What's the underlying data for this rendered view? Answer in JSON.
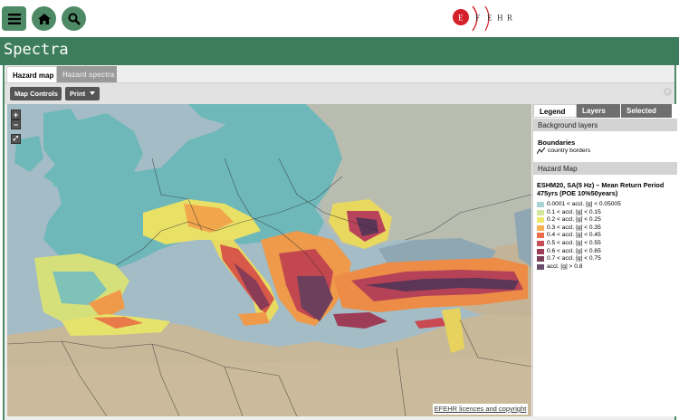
{
  "header": {
    "menu_icon": "hamburger-menu-icon",
    "home_icon": "home-icon",
    "search_icon": "search-icon",
    "logo": {
      "letters": "E F E H R",
      "accent": "#d4202a"
    },
    "brand_color": "#4e8a66"
  },
  "title": "Spectra",
  "tabs": [
    {
      "label": "Hazard map",
      "active": true
    },
    {
      "label": "Hazard spectra",
      "active": false
    }
  ],
  "toolbar": {
    "map_controls": "Map Controls",
    "print": "Print"
  },
  "map": {
    "zoom_in": "+",
    "zoom_out": "−",
    "copyright": "EFEHR licences and copyright"
  },
  "panel": {
    "tabs": [
      "Legend",
      "Layers",
      "Selected"
    ],
    "background_layers": "Background layers",
    "boundaries": "Boundaries",
    "country_borders": "country borders",
    "hazard_map": "Hazard Map",
    "legend_title": "ESHM20, SA(5 Hz) – Mean Return Period 475yrs (POE 10%50years)",
    "legend": [
      {
        "label": "0.0001 < accl. [g] < 0.05005",
        "color": "#a8d4d4"
      },
      {
        "label": "0.1 < accl. [g] < 0.15",
        "color": "#d2e69c"
      },
      {
        "label": "0.2 < accl. [g] < 0.25",
        "color": "#efe86a"
      },
      {
        "label": "0.3 < accl. [g] < 0.35",
        "color": "#f4b052"
      },
      {
        "label": "0.4 < accl. [g] < 0.45",
        "color": "#ea6e4a"
      },
      {
        "label": "0.5 < accl. [g] < 0.55",
        "color": "#c74d55"
      },
      {
        "label": "0.6 < accl. [g] < 0.65",
        "color": "#9c3c56"
      },
      {
        "label": "0.7 < accl. [g] < 0.75",
        "color": "#7a3e5a"
      },
      {
        "label": "accl. [g] > 0.8",
        "color": "#6a4f6c"
      }
    ]
  }
}
